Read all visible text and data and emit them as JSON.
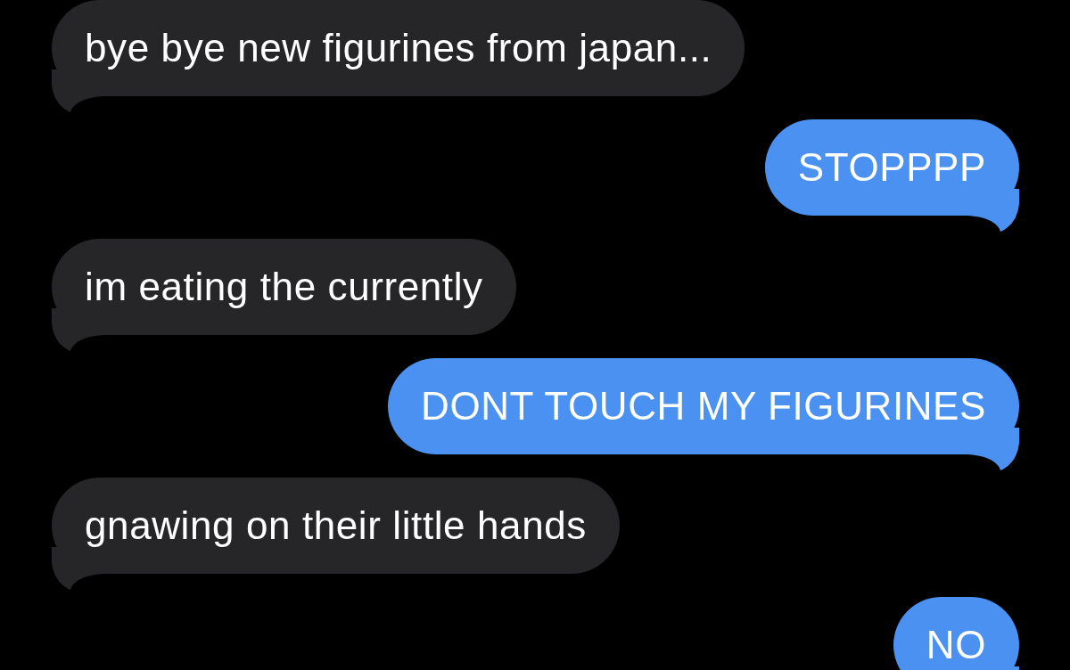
{
  "messages": [
    {
      "kind": "received",
      "text": "bye bye new figurines from japan..."
    },
    {
      "kind": "sent",
      "text": "STOPPPP"
    },
    {
      "kind": "received",
      "text": "im eating the currently"
    },
    {
      "kind": "sent",
      "text": "DONT TOUCH MY FIGURINES"
    },
    {
      "kind": "received",
      "text": "gnawing on their little hands"
    },
    {
      "kind": "sent",
      "text": "NO"
    }
  ]
}
